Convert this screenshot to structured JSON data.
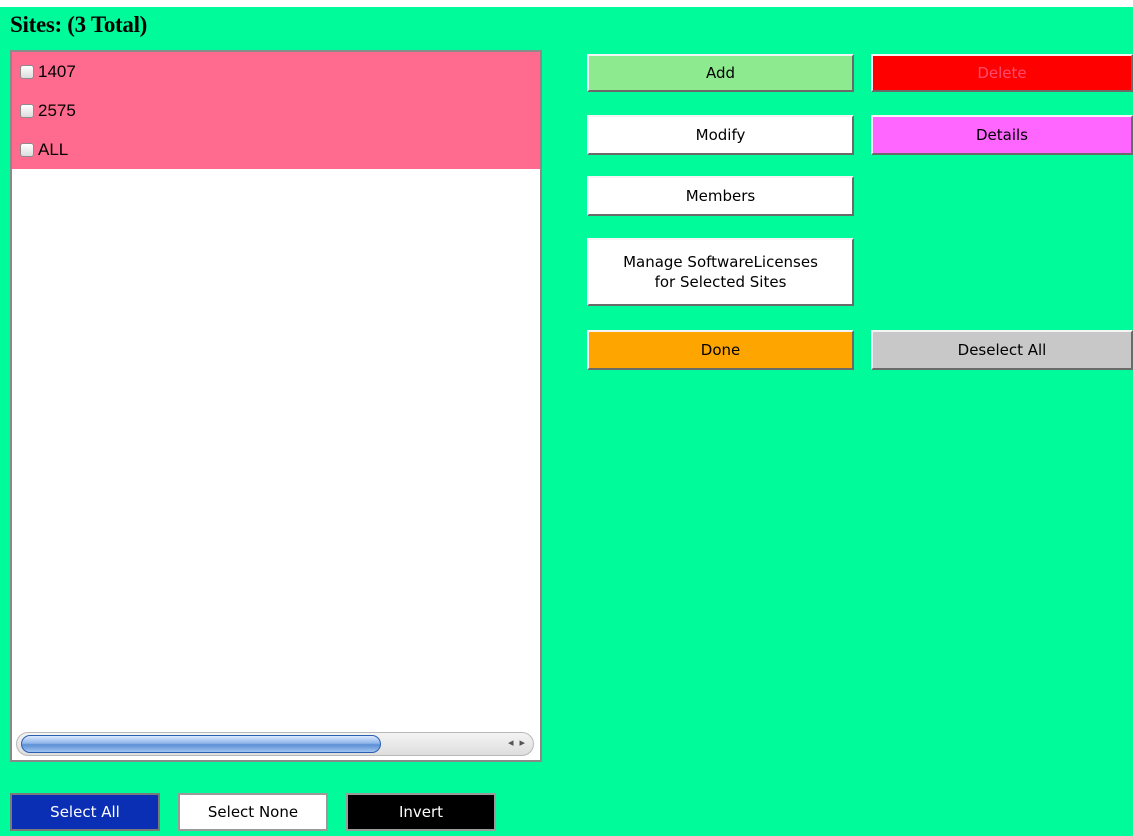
{
  "title": "Sites: (3 Total)",
  "sites": [
    {
      "label": "1407",
      "checked": false
    },
    {
      "label": "2575",
      "checked": false
    },
    {
      "label": "ALL",
      "checked": false
    }
  ],
  "list_scroll": {
    "left_arrow": "◂",
    "right_arrow": "▸"
  },
  "buttons": {
    "add": "Add",
    "delete": "Delete",
    "modify": "Modify",
    "details": "Details",
    "members": "Members",
    "manage": "Manage SoftwareLicenses\nfor Selected Sites",
    "done": "Done",
    "deselect_all": "Deselect All",
    "select_all": "Select All",
    "select_none": "Select None",
    "invert": "Invert"
  },
  "colors": {
    "background": "#00fb9a",
    "row_selected": "#ff6b8e",
    "add": "#8eea8e",
    "delete": "#ff0000",
    "details": "#ff66ff",
    "done": "#ffa500",
    "deselect_all": "#c8c8c8",
    "select_all": "#0a2fb5",
    "invert": "#000000"
  }
}
